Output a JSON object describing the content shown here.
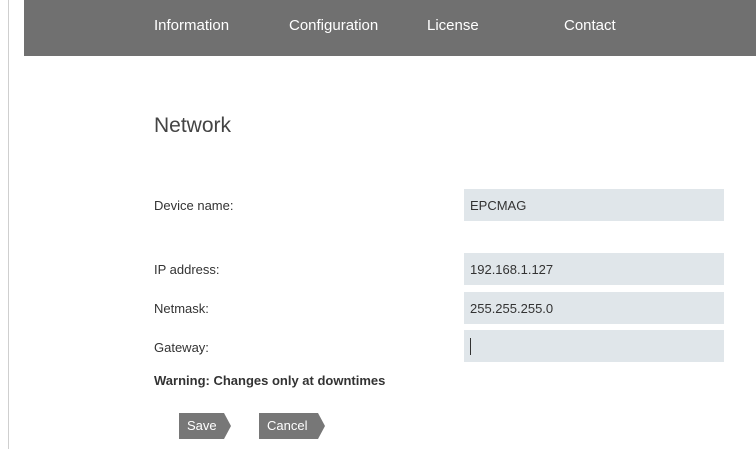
{
  "nav": {
    "items": [
      {
        "label": "Information"
      },
      {
        "label": "Configuration"
      },
      {
        "label": "License"
      },
      {
        "label": "Contact"
      }
    ]
  },
  "page": {
    "title": "Network"
  },
  "form": {
    "device_name": {
      "label": "Device name:",
      "value": "EPCMAG"
    },
    "ip_address": {
      "label": "IP address:",
      "value": "192.168.1.127"
    },
    "netmask": {
      "label": "Netmask:",
      "value": "255.255.255.0"
    },
    "gateway": {
      "label": "Gateway:",
      "value": ""
    },
    "warning": "Warning: Changes only at downtimes"
  },
  "actions": {
    "save_label": "Save",
    "cancel_label": "Cancel"
  },
  "colors": {
    "navbar": "#707070",
    "field_bg": "#e0e6ea",
    "button_bg": "#777777"
  }
}
